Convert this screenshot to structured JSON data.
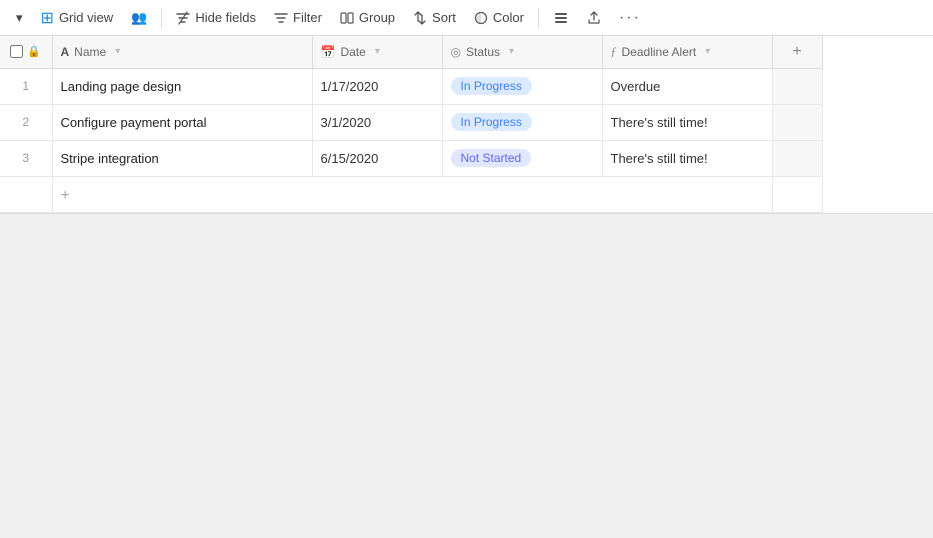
{
  "toolbar": {
    "dropdown_arrow": "▾",
    "view_icon": "⊞",
    "view_label": "Grid view",
    "people_icon": "👥",
    "hide_fields_icon": "⊘",
    "hide_fields_label": "Hide fields",
    "filter_icon": "≡",
    "filter_label": "Filter",
    "group_icon": "▤",
    "group_label": "Group",
    "sort_icon": "⇅",
    "sort_label": "Sort",
    "color_icon": "◉",
    "color_label": "Color",
    "lines_icon": "☰",
    "share_icon": "⬡",
    "more_icon": "•••"
  },
  "table": {
    "columns": [
      {
        "id": "checkbox",
        "label": "",
        "type": "checkbox"
      },
      {
        "id": "name",
        "label": "Name",
        "icon": "A",
        "icon_color": "#555"
      },
      {
        "id": "date",
        "label": "Date",
        "icon": "📅"
      },
      {
        "id": "status",
        "label": "Status",
        "icon": "◎"
      },
      {
        "id": "deadline_alert",
        "label": "Deadline Alert",
        "icon": "ƒ"
      }
    ],
    "rows": [
      {
        "num": "1",
        "name": "Landing page design",
        "date": "1/17/2020",
        "status": "In Progress",
        "status_type": "in-progress",
        "deadline_alert": "Overdue"
      },
      {
        "num": "2",
        "name": "Configure payment portal",
        "date": "3/1/2020",
        "status": "In Progress",
        "status_type": "in-progress",
        "deadline_alert": "There's still time!"
      },
      {
        "num": "3",
        "name": "Stripe integration",
        "date": "6/15/2020",
        "status": "Not Started",
        "status_type": "not-started",
        "deadline_alert": "There's still time!"
      }
    ],
    "add_row_label": "+",
    "add_col_label": "+"
  }
}
